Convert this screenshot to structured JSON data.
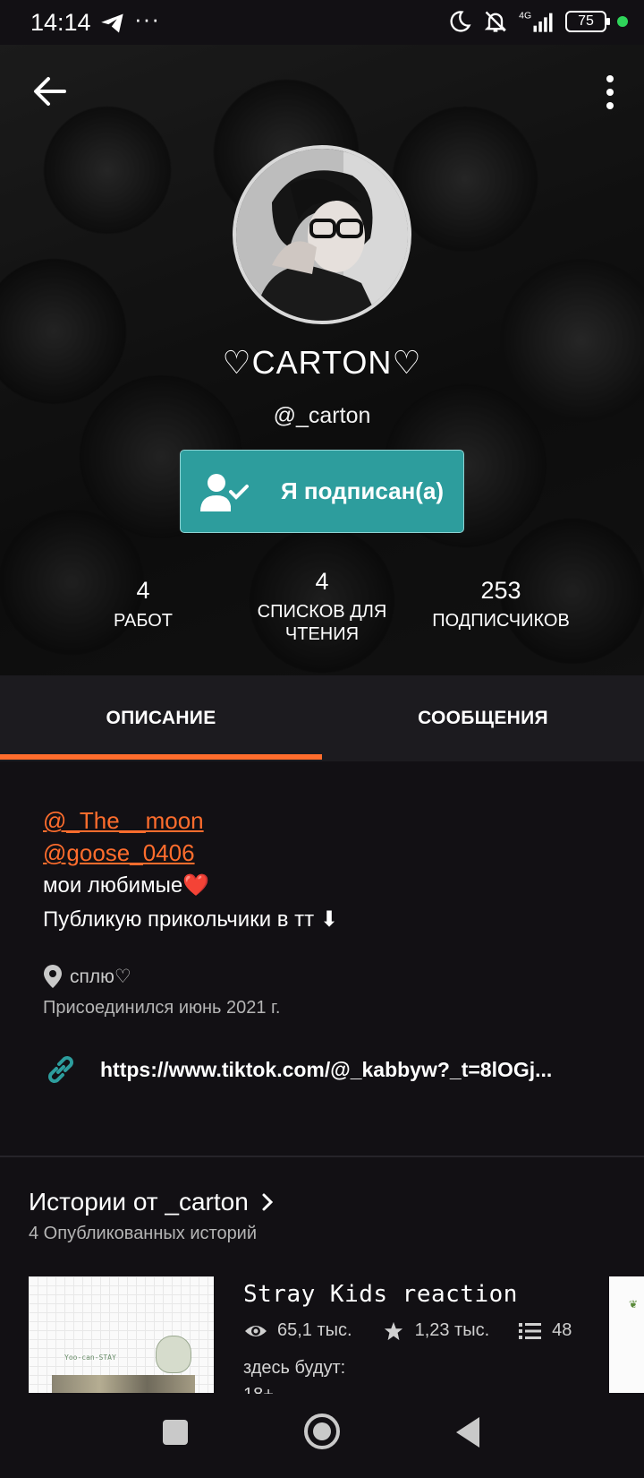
{
  "status_bar": {
    "time": "14:14",
    "dots": "···",
    "network": "4G",
    "battery": "75",
    "icons": [
      "telegram-icon",
      "moon-icon",
      "bell-off-icon",
      "signal-icon",
      "battery-icon"
    ]
  },
  "profile": {
    "display_name": "♡CARTON♡",
    "username": "@_carton",
    "follow_label": "Я подписан(а)",
    "stats": [
      {
        "value": "4",
        "label": "РАБОТ"
      },
      {
        "value": "4",
        "label_line1": "СПИСКОВ ДЛЯ",
        "label_line2": "ЧТЕНИЯ"
      },
      {
        "value": "253",
        "label": "ПОДПИСЧИКОВ"
      }
    ]
  },
  "tabs": [
    {
      "label": "ОПИСАНИЕ",
      "active": true
    },
    {
      "label": "СООБЩЕНИЯ",
      "active": false
    }
  ],
  "about": {
    "mentions": [
      "@_The__moon",
      "@goose_0406"
    ],
    "bio_line1": "мои любимые",
    "bio_heart": "❤️",
    "bio_line2": "Публикую прикольчики в тт ⬇",
    "location": "сплю♡",
    "joined": "Присоединился июнь 2021 г.",
    "link": "https://www.tiktok.com/@_kabbyw?_t=8lOGj..."
  },
  "stories": {
    "title": "Истории от _carton",
    "subtitle": "4 Опубликованных историй",
    "items": [
      {
        "title": "Stray Kids reaction",
        "views": "65,1 тыс.",
        "votes": "1,23 тыс.",
        "parts": "48",
        "description": "здесь будут:",
        "description2": "18+",
        "cover_text": "Yoo-can-STAY"
      }
    ]
  },
  "colors": {
    "accent": "#ff6d2d",
    "follow_button": "#2d9d9d",
    "background": "#121014",
    "tab_bar": "#1c1b1f"
  }
}
